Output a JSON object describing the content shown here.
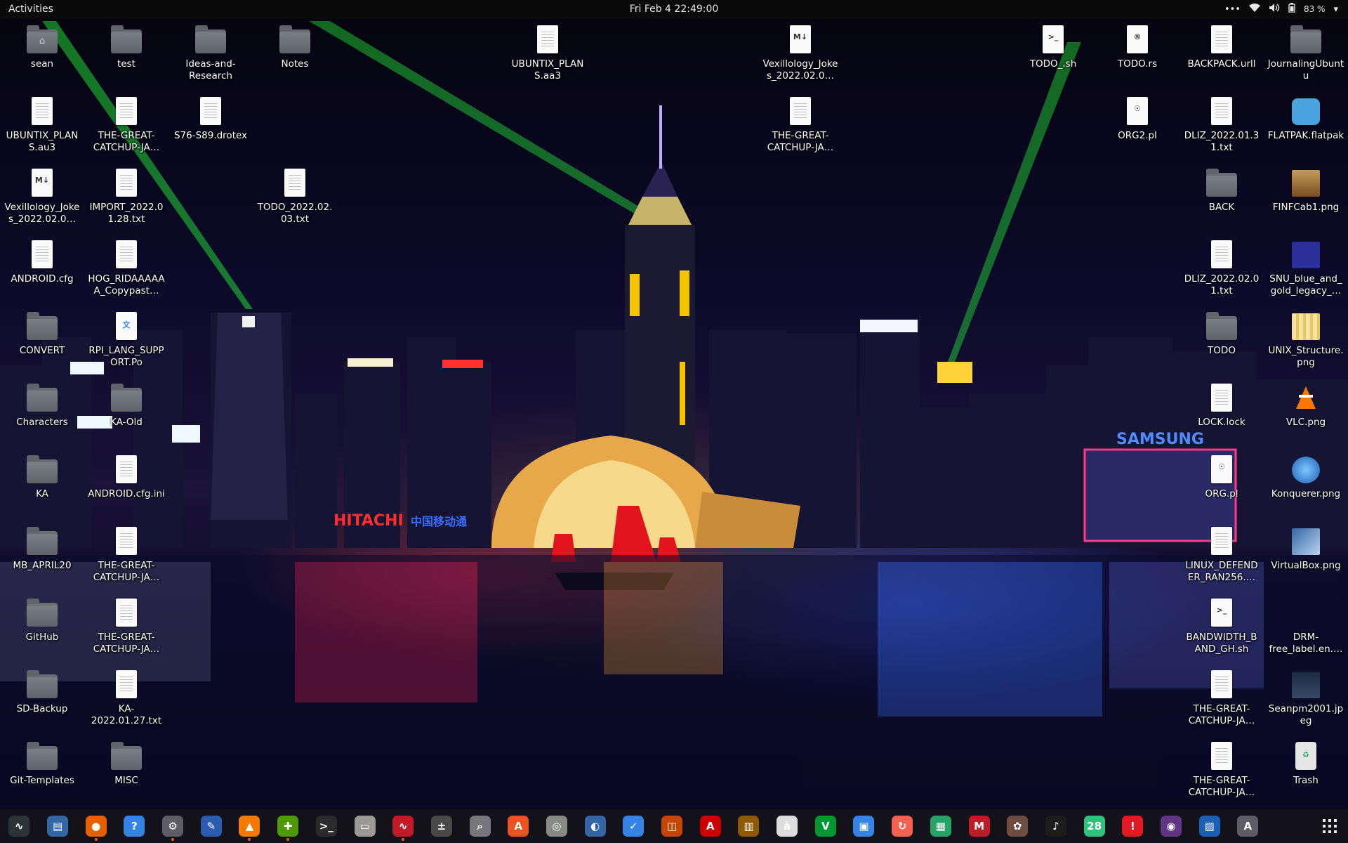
{
  "topbar": {
    "activities": "Activities",
    "clock": "Fri Feb 4  22:49:00",
    "battery": "83 %",
    "icons": [
      "overflow-dots-icon",
      "wifi-icon",
      "volume-icon",
      "battery-icon",
      "chevron-down-icon"
    ]
  },
  "wallpaper": {
    "signs": {
      "hitachi": "HITACHI",
      "chinese": "中国移动通",
      "samsung": "SAMSUNG"
    }
  },
  "desktop_icons": [
    {
      "label": "sean",
      "kind": "home-folder"
    },
    {
      "label": "test",
      "kind": "folder"
    },
    {
      "label": "Ideas-and-Research",
      "kind": "folder"
    },
    {
      "label": "Notes",
      "kind": "folder"
    },
    {
      "label": "UBUNTIX_PLANS.aa3",
      "kind": "file"
    },
    {
      "label": "Vexillology_Jokes_2022.02.0…",
      "kind": "markdown"
    },
    {
      "label": "TODO_.sh",
      "kind": "script"
    },
    {
      "label": "TODO.rs",
      "kind": "rust"
    },
    {
      "label": "BACKPACK.urll",
      "kind": "file"
    },
    {
      "label": "JournalingUbuntu",
      "kind": "folder"
    },
    {
      "label": "UBUNTIX_PLANS.au3",
      "kind": "file"
    },
    {
      "label": "THE-GREAT-CATCHUP-JA…",
      "kind": "file"
    },
    {
      "label": "S76-S89.drotex",
      "kind": "file"
    },
    {
      "label": "THE-GREAT-CATCHUP-JA…",
      "kind": "file"
    },
    {
      "label": "ORG2.pl",
      "kind": "perl"
    },
    {
      "label": "DLIZ_2022.01.31.txt",
      "kind": "file"
    },
    {
      "label": "FLATPAK.flatpak",
      "kind": "flatpak"
    },
    {
      "label": "Vexillology_Jokes_2022.02.0…",
      "kind": "markdown"
    },
    {
      "label": "IMPORT_2022.01.28.txt",
      "kind": "file"
    },
    {
      "label": "TODO_2022.02.03.txt",
      "kind": "file"
    },
    {
      "label": "BACK",
      "kind": "folder"
    },
    {
      "label": "FINFCab1.png",
      "kind": "image-cabinet"
    },
    {
      "label": "ANDROID.cfg",
      "kind": "file"
    },
    {
      "label": "HOG_RIDAAAAAA_Copypast…",
      "kind": "file"
    },
    {
      "label": "DLIZ_2022.02.01.txt",
      "kind": "file"
    },
    {
      "label": "SNU_blue_and_gold_legacy_…",
      "kind": "image-snu"
    },
    {
      "label": "CONVERT",
      "kind": "folder"
    },
    {
      "label": "RPI_LANG_SUPPORT.Po",
      "kind": "translation"
    },
    {
      "label": "TODO",
      "kind": "folder"
    },
    {
      "label": "UNIX_Structure.png",
      "kind": "image-unix"
    },
    {
      "label": "Characters",
      "kind": "folder"
    },
    {
      "label": "KA-Old",
      "kind": "folder"
    },
    {
      "label": "LOCK.lock",
      "kind": "file"
    },
    {
      "label": "VLC.png",
      "kind": "image-vlc"
    },
    {
      "label": "KA",
      "kind": "folder"
    },
    {
      "label": "ANDROID.cfg.ini",
      "kind": "file"
    },
    {
      "label": "ORG.pl",
      "kind": "perl"
    },
    {
      "label": "Konquerer.png",
      "kind": "image-konq"
    },
    {
      "label": "MB_APRIL20",
      "kind": "folder"
    },
    {
      "label": "THE-GREAT-CATCHUP-JA…",
      "kind": "file"
    },
    {
      "label": "LINUX_DEFENDER_RAN256.…",
      "kind": "file"
    },
    {
      "label": "VirtualBox.png",
      "kind": "image-vbox"
    },
    {
      "label": "GitHub",
      "kind": "folder"
    },
    {
      "label": "THE-GREAT-CATCHUP-JA…",
      "kind": "file"
    },
    {
      "label": "BANDWIDTH_BAND_GH.sh",
      "kind": "script"
    },
    {
      "label": "DRM-free_label.en.…",
      "kind": "image-drm"
    },
    {
      "label": "SD-Backup",
      "kind": "folder"
    },
    {
      "label": "KA-2022.01.27.txt",
      "kind": "file"
    },
    {
      "label": "THE-GREAT-CATCHUP-JA…",
      "kind": "file"
    },
    {
      "label": "Seanpm2001.jpeg",
      "kind": "image-photo"
    },
    {
      "label": "Git-Templates",
      "kind": "folder"
    },
    {
      "label": "MISC",
      "kind": "folder"
    },
    {
      "label": "THE-GREAT-CATCHUP-JA…",
      "kind": "file"
    },
    {
      "label": "Trash",
      "kind": "trash"
    }
  ],
  "dock": {
    "apps": [
      {
        "name": "system-monitor",
        "glyph": "∿",
        "color": "#2e3436",
        "running": false
      },
      {
        "name": "document-viewer",
        "glyph": "▤",
        "color": "#3465a4",
        "running": false
      },
      {
        "name": "firefox",
        "glyph": "●",
        "color": "#e66000",
        "running": true
      },
      {
        "name": "help",
        "glyph": "?",
        "color": "#3584e4",
        "running": false
      },
      {
        "name": "settings",
        "glyph": "⚙",
        "color": "#5e5c64",
        "running": true
      },
      {
        "name": "text-editor",
        "glyph": "✎",
        "color": "#2a5db0",
        "running": false
      },
      {
        "name": "vlc",
        "glyph": "▲",
        "color": "#f57900",
        "running": true
      },
      {
        "name": "puzzle",
        "glyph": "✚",
        "color": "#4e9a06",
        "running": true
      },
      {
        "name": "terminal",
        "glyph": ">_",
        "color": "#2b2b2b",
        "running": false
      },
      {
        "name": "files",
        "glyph": "▭",
        "color": "#9a9996",
        "running": false
      },
      {
        "name": "resource-monitor",
        "glyph": "∿",
        "color": "#c01c28",
        "running": true
      },
      {
        "name": "calculator",
        "glyph": "±",
        "color": "#494949",
        "running": false
      },
      {
        "name": "search-utility",
        "glyph": "⌕",
        "color": "#77767b",
        "running": false
      },
      {
        "name": "software-store",
        "glyph": "A",
        "color": "#e95420",
        "running": false
      },
      {
        "name": "disk-tool",
        "glyph": "◎",
        "color": "#888a85",
        "running": false
      },
      {
        "name": "scanner",
        "glyph": "◐",
        "color": "#3465a4",
        "running": false
      },
      {
        "name": "tasks",
        "glyph": "✓",
        "color": "#3584e4",
        "running": false
      },
      {
        "name": "screenshot",
        "glyph": "◫",
        "color": "#c64600",
        "running": false
      },
      {
        "name": "font-viewer",
        "glyph": "A",
        "color": "#cc0000",
        "running": false
      },
      {
        "name": "archive-manager",
        "glyph": "▥",
        "color": "#8f5902",
        "running": false
      },
      {
        "name": "character-map",
        "glyph": "à",
        "color": "#dcdcdc",
        "running": false
      },
      {
        "name": "vim",
        "glyph": "V",
        "color": "#019833",
        "running": false
      },
      {
        "name": "remote-desktop",
        "glyph": "▣",
        "color": "#3584e4",
        "running": false
      },
      {
        "name": "backup",
        "glyph": "↻",
        "color": "#f66151",
        "running": false
      },
      {
        "name": "spreadsheet",
        "glyph": "▦",
        "color": "#26a269",
        "running": false
      },
      {
        "name": "mario-game",
        "glyph": "M",
        "color": "#c01c28",
        "running": false
      },
      {
        "name": "gimp",
        "glyph": "✿",
        "color": "#6d4c41",
        "running": false
      },
      {
        "name": "music",
        "glyph": "♪",
        "color": "#1c1c1c",
        "running": false
      },
      {
        "name": "calendar",
        "glyph": "28",
        "color": "#2ec27e",
        "running": false
      },
      {
        "name": "error-reporter",
        "glyph": "!",
        "color": "#e01b24",
        "running": false
      },
      {
        "name": "camera",
        "glyph": "◉",
        "color": "#613583",
        "running": false
      },
      {
        "name": "image-editor",
        "glyph": "▨",
        "color": "#1a5fb4",
        "running": false
      },
      {
        "name": "software-updater",
        "glyph": "A",
        "color": "#5e5c64",
        "running": false
      }
    ],
    "show_apps_icon": "app-grid-icon"
  }
}
